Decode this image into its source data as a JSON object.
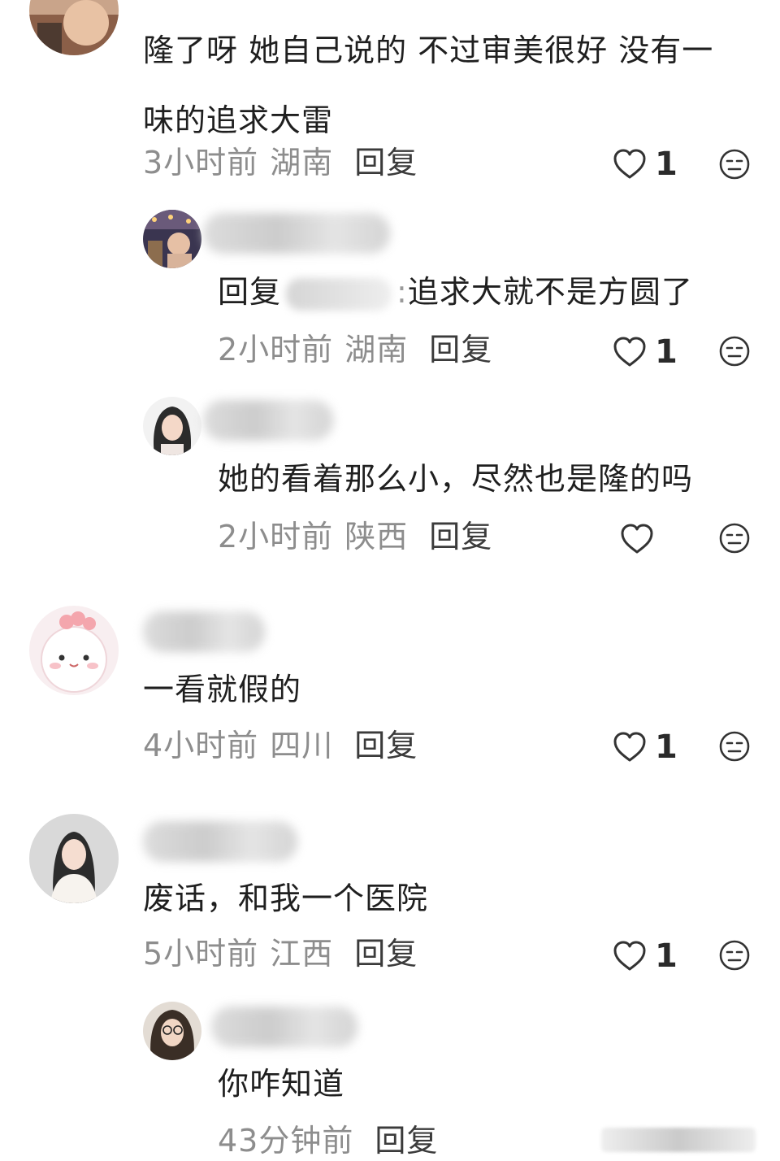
{
  "colors": {
    "text": "#1f1f1f",
    "meta": "#8d8d8d",
    "reply_button": "#3b3b3b",
    "background": "#ffffff"
  },
  "comments": [
    {
      "text": "隆了呀 她自己说的 不过审美很好 没有一味的追求大雷",
      "time": "3小时前",
      "location": "湖南",
      "reply_label": "回复",
      "likes": "1",
      "icons": [
        "avatar",
        "heart-icon",
        "dislike-face-icon"
      ]
    },
    {
      "reply_prefix": "回复",
      "reply_colon": ":",
      "text": "追求大就不是方圆了",
      "time": "2小时前",
      "location": "湖南",
      "reply_label": "回复",
      "likes": "1",
      "icons": [
        "avatar",
        "heart-icon",
        "dislike-face-icon"
      ]
    },
    {
      "text": "她的看着那么小，尽然也是隆的吗",
      "time": "2小时前",
      "location": "陕西",
      "reply_label": "回复",
      "likes": "",
      "icons": [
        "avatar",
        "heart-icon",
        "dislike-face-icon"
      ]
    },
    {
      "text": "一看就假的",
      "time": "4小时前",
      "location": "四川",
      "reply_label": "回复",
      "likes": "1",
      "icons": [
        "avatar",
        "heart-icon",
        "dislike-face-icon"
      ]
    },
    {
      "text": "废话，和我一个医院",
      "time": "5小时前",
      "location": "江西",
      "reply_label": "回复",
      "likes": "1",
      "icons": [
        "avatar",
        "heart-icon",
        "dislike-face-icon"
      ]
    },
    {
      "text": "你咋知道",
      "time": "43分钟前",
      "reply_label": "回复",
      "icons": [
        "avatar"
      ]
    }
  ]
}
